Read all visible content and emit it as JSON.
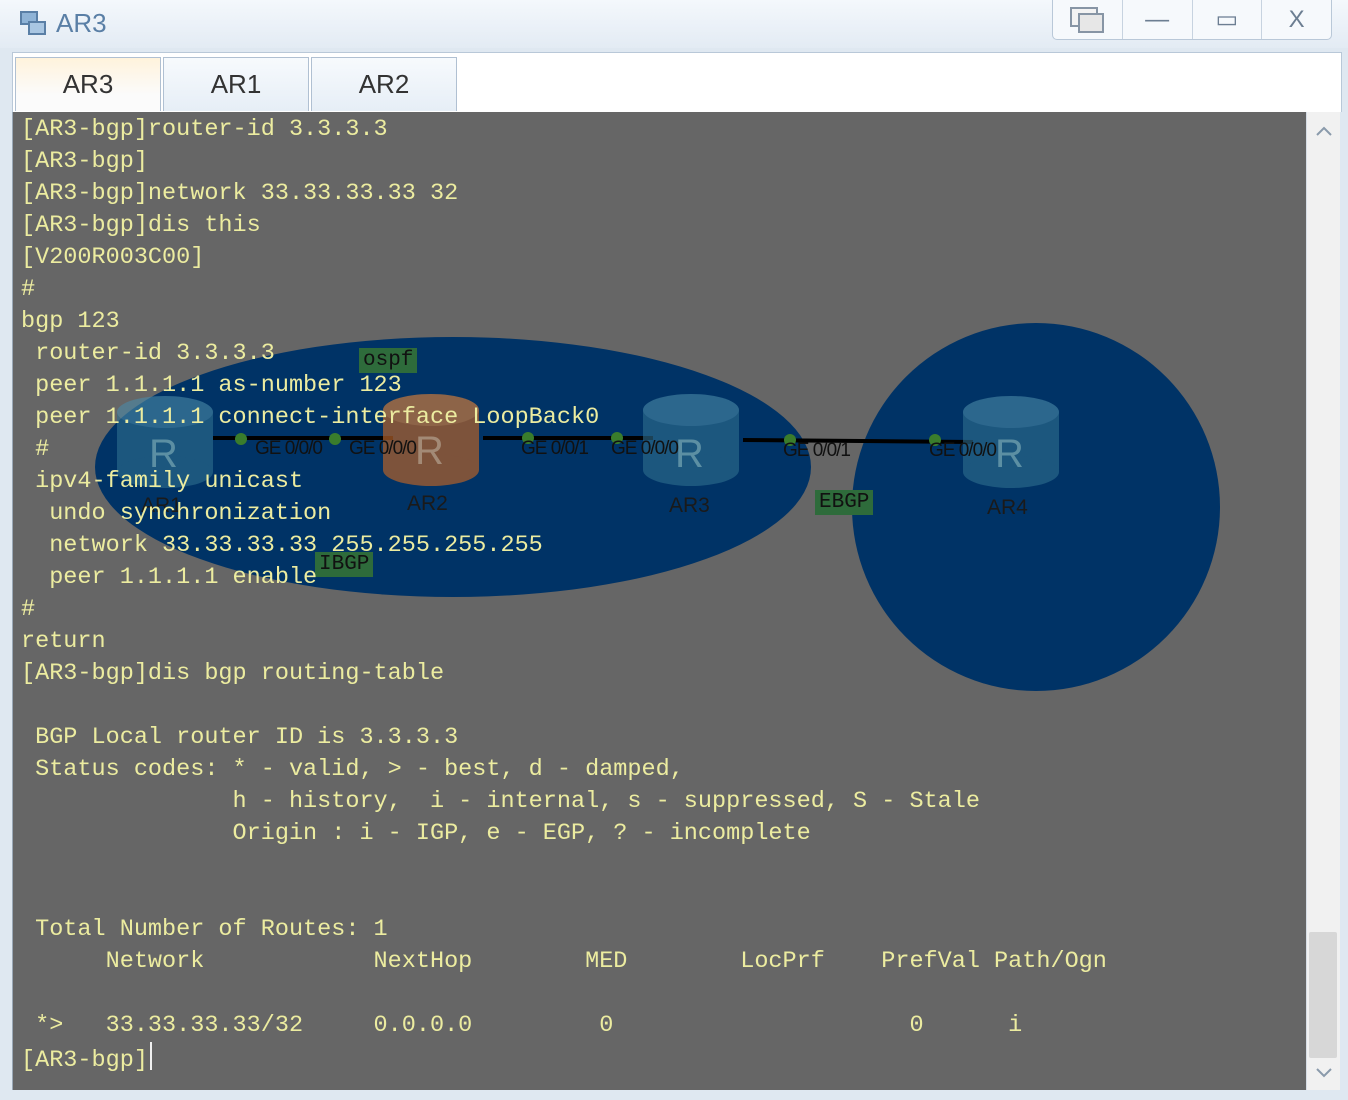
{
  "window": {
    "title": "AR3",
    "buttons": {
      "restore_icon": "restore-windows-icon",
      "minimize": "—",
      "maximize": "▭",
      "close": "X"
    }
  },
  "tabs": [
    {
      "label": "AR3",
      "active": true
    },
    {
      "label": "AR1",
      "active": false
    },
    {
      "label": "AR2",
      "active": false
    }
  ],
  "terminal": {
    "lines": [
      "[AR3-bgp]router-id 3.3.3.3",
      "[AR3-bgp]",
      "[AR3-bgp]network 33.33.33.33 32",
      "[AR3-bgp]dis this",
      "[V200R003C00]",
      "#",
      "bgp 123",
      " router-id 3.3.3.3",
      " peer 1.1.1.1 as-number 123",
      " peer 1.1.1.1 connect-interface LoopBack0",
      " #",
      " ipv4-family unicast",
      "  undo synchronization",
      "  network 33.33.33.33 255.255.255.255",
      "  peer 1.1.1.1 enable",
      "#",
      "return",
      "[AR3-bgp]dis bgp routing-table",
      "",
      " BGP Local router ID is 3.3.3.3",
      " Status codes: * - valid, > - best, d - damped,",
      "               h - history,  i - internal, s - suppressed, S - Stale",
      "               Origin : i - IGP, e - EGP, ? - incomplete",
      "",
      "",
      " Total Number of Routes: 1",
      "      Network            NextHop        MED        LocPrf    PrefVal Path/Ogn",
      "",
      " *>   33.33.33.33/32     0.0.0.0         0                     0      i",
      "[AR3-bgp]"
    ],
    "text_color": "#ececa0",
    "background": "#666666"
  },
  "topology": {
    "devices": [
      {
        "name": "AR1"
      },
      {
        "name": "AR2"
      },
      {
        "name": "AR3"
      },
      {
        "name": "AR4"
      }
    ],
    "interfaces": [
      "GE 0/0/0",
      "GE 0/0/0",
      "GE 0/0/1",
      "GE 0/0/0",
      "GE 0/0/1",
      "GE 0/0/0"
    ],
    "tags": {
      "ospf": "ospf",
      "ibgp": "IBGP",
      "ebgp": "EBGP"
    },
    "colors": {
      "area": "#003366",
      "router_blue": "#2f6f8f",
      "router_orange": "#b3612a",
      "tag": "#2e6b3b"
    }
  },
  "scrollbar": {
    "up_icon": "chevron-up-icon",
    "down_icon": "chevron-down-icon"
  }
}
